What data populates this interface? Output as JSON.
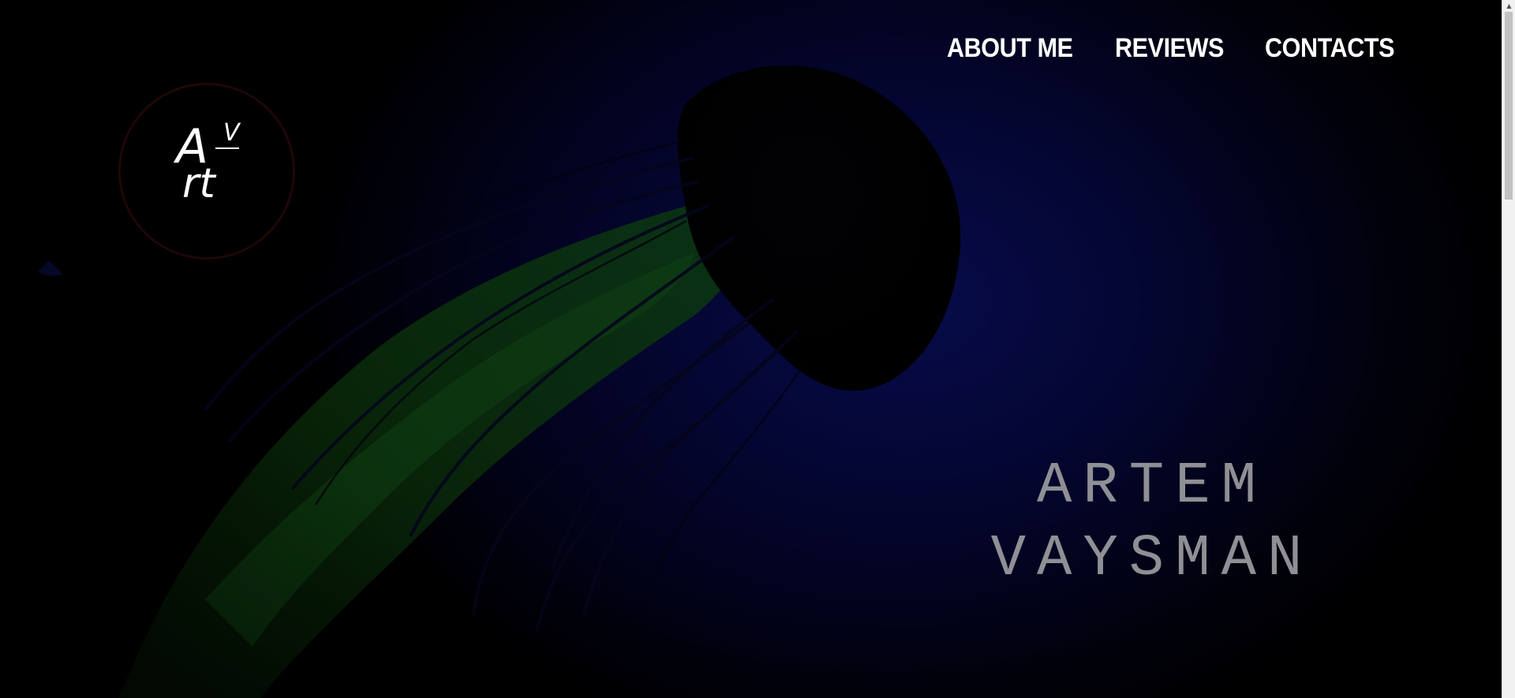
{
  "nav": {
    "items": [
      {
        "label": "ABOUT ME"
      },
      {
        "label": "REVIEWS"
      },
      {
        "label": "CONTACTS"
      }
    ]
  },
  "logo": {
    "top_left": "A",
    "top_right": "V",
    "bottom": "rt"
  },
  "hero": {
    "first_name": "ARTEM",
    "last_name": "VAYSMAN"
  },
  "colors": {
    "background": "#000000",
    "deep_blue": "#070b4a",
    "name_text": "#8f8f95",
    "nav_text": "#ffffff",
    "jellyfish_green": "#0c3a0c"
  },
  "icons": {
    "scroll_up": "triangle-up-icon"
  }
}
